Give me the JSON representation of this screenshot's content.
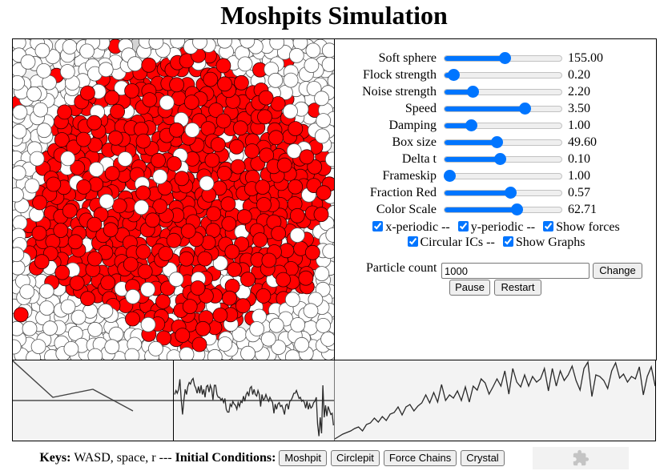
{
  "page": {
    "title": "Moshpits Simulation"
  },
  "simulation": {
    "particle_count": 1000,
    "colors": {
      "red": "#ff0000",
      "white": "#ffffff",
      "highlight": "#d3d3d3",
      "red_outline": "#330000",
      "white_outline": "#555555"
    }
  },
  "accent_color": "#0075ff",
  "controls": {
    "sliders": [
      {
        "label": "Soft sphere",
        "value": "155.00",
        "position": 0.52
      },
      {
        "label": "Flock strength",
        "value": "0.20",
        "position": 0.04
      },
      {
        "label": "Noise strength",
        "value": "2.20",
        "position": 0.22
      },
      {
        "label": "Speed",
        "value": "3.50",
        "position": 0.71
      },
      {
        "label": "Damping",
        "value": "1.00",
        "position": 0.2
      },
      {
        "label": "Box size",
        "value": "49.60",
        "position": 0.44
      },
      {
        "label": "Delta t",
        "value": "0.10",
        "position": 0.47
      },
      {
        "label": "Frameskip",
        "value": "1.00",
        "position": 0.0
      },
      {
        "label": "Fraction Red",
        "value": "0.57",
        "position": 0.57
      },
      {
        "label": "Color Scale",
        "value": "62.71",
        "position": 0.63
      }
    ],
    "checkboxes": [
      {
        "label": "x-periodic --",
        "checked": true
      },
      {
        "label": "y-periodic --",
        "checked": true
      },
      {
        "label": "Show forces",
        "checked": true
      },
      {
        "label": "Circular ICs --",
        "checked": true
      },
      {
        "label": "Show Graphs",
        "checked": true
      }
    ],
    "particle_count": {
      "label": "Particle count",
      "value": "1000"
    },
    "change_label": "Change",
    "pause_label": "Pause",
    "restart_label": "Restart"
  },
  "graphs": [
    {
      "range": [
        -1,
        1
      ],
      "reference_line": 0,
      "values": [
        1.0,
        0.08,
        0.28,
        -0.26
      ]
    },
    {
      "range": [
        -1,
        1
      ],
      "reference_line": 0,
      "values": [
        0.15,
        0.25,
        0.18,
        0.28,
        0.53,
        0.01,
        -0.35,
        0.01,
        0.28,
        0.15,
        0.35,
        0.45,
        0.41,
        0.51,
        0.55,
        0.38,
        0.31,
        0.18,
        0.35,
        0.18,
        0.38,
        0.15,
        0.28,
        0.08,
        0.35,
        0.38,
        0.21,
        0.38,
        0.28,
        0.01,
        0.38,
        0.38,
        0.15,
        0.08,
        0.08,
        0.01,
        0.05,
        -0.05,
        0.05,
        -0.22,
        -0.29,
        -0.29,
        -0.09,
        -0.15,
        -0.02,
        -0.09,
        -0.12,
        -0.22,
        -0.05,
        -0.15,
        -0.02,
        -0.05,
        0.11,
        -0.02,
        0.15,
        0.21,
        0.11,
        0.31,
        0.35,
        0.15,
        0.28,
        0.15,
        0.11,
        0.25,
        0.15,
        -0.15,
        0.15,
        0.01,
        0.05,
        0.15,
        0.05,
        -0.02,
        0.08,
        0.01,
        -0.05,
        -0.32,
        -0.09,
        -0.22,
        -0.09,
        -0.05,
        -0.15,
        -0.12,
        -0.22,
        -0.35,
        -0.12,
        -0.09,
        -0.22,
        -0.02,
        0.01,
        0.08,
        0.18,
        0.18,
        0.25,
        0.15,
        0.05,
        0.08,
        -0.02,
        0.01,
        -0.05,
        -0.19,
        -0.02,
        -0.22,
        -0.09,
        -0.19,
        -0.15,
        -0.05,
        -0.02,
        0.08,
        -0.59,
        -0.89,
        -0.42,
        -0.82,
        0.38,
        -0.42,
        -0.12,
        -0.39,
        -0.15,
        -0.25,
        -0.35,
        -0.32,
        -0.62
      ]
    },
    {
      "range": [
        0,
        1
      ],
      "reference_line": null,
      "values": [
        0.02,
        0.05,
        0.08,
        0.1,
        0.12,
        0.15,
        0.17,
        0.12,
        0.2,
        0.22,
        0.28,
        0.23,
        0.3,
        0.25,
        0.33,
        0.35,
        0.42,
        0.32,
        0.42,
        0.45,
        0.37,
        0.43,
        0.47,
        0.57,
        0.47,
        0.6,
        0.48,
        0.7,
        0.5,
        0.57,
        0.53,
        0.62,
        0.5,
        0.67,
        0.48,
        0.68,
        0.63,
        0.77,
        0.72,
        0.58,
        0.67,
        0.77,
        0.68,
        0.87,
        0.58,
        0.9,
        0.73,
        0.67,
        0.82,
        0.68,
        0.8,
        0.73,
        0.77,
        0.9,
        0.62,
        0.9,
        0.68,
        0.87,
        0.75,
        0.82,
        0.93,
        0.75,
        0.63,
        0.9,
        0.98,
        0.55,
        0.82,
        0.8,
        0.75,
        0.65,
        0.87,
        0.97,
        0.78,
        0.83,
        0.73,
        0.8,
        0.77,
        0.92,
        0.57,
        0.8,
        0.92,
        0.68
      ]
    }
  ],
  "footer": {
    "keys_label": "Keys:",
    "keys_text": "WASD, space, r ---",
    "ic_label": "Initial Conditions:",
    "buttons": [
      "Moshpit",
      "Circlepit",
      "Force Chains",
      "Crystal"
    ],
    "plugin_icon": "puzzle-icon"
  }
}
